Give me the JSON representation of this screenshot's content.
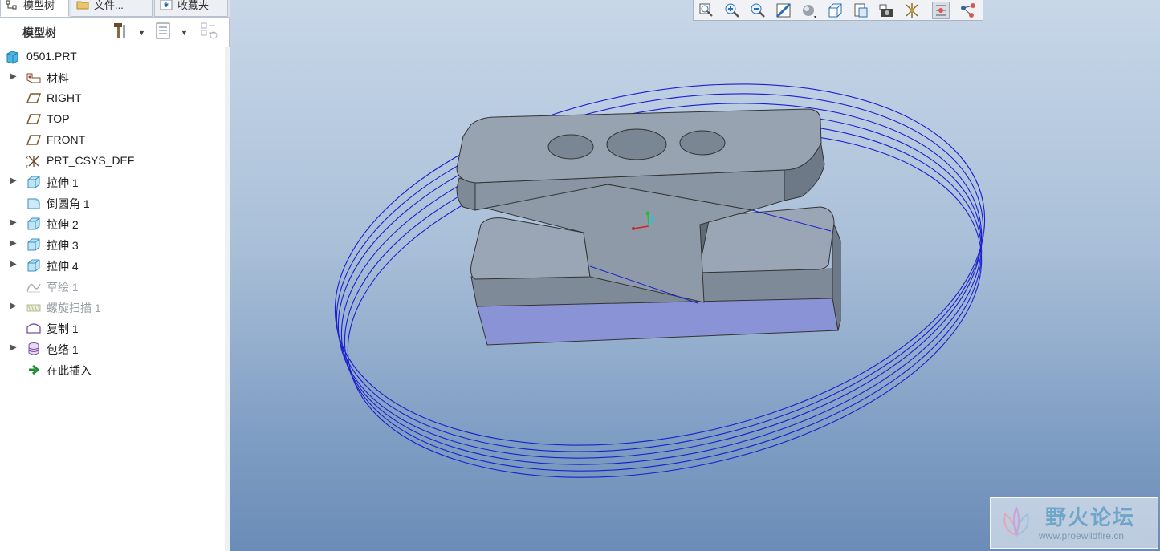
{
  "tabs": [
    {
      "label": "模型树"
    },
    {
      "label": "文件..."
    },
    {
      "label": "收藏夹"
    }
  ],
  "panel": {
    "title": "模型树"
  },
  "tree": {
    "root": "0501.PRT",
    "items": [
      {
        "label": "材料",
        "icon": "material-icon",
        "expandable": true
      },
      {
        "label": "RIGHT",
        "icon": "datum-plane-icon",
        "expandable": false
      },
      {
        "label": "TOP",
        "icon": "datum-plane-icon",
        "expandable": false
      },
      {
        "label": "FRONT",
        "icon": "datum-plane-icon",
        "expandable": false
      },
      {
        "label": "PRT_CSYS_DEF",
        "icon": "coordinate-system-icon",
        "expandable": false
      },
      {
        "label": "拉伸 1",
        "icon": "extrude-icon",
        "expandable": true
      },
      {
        "label": "倒圆角 1",
        "icon": "round-icon",
        "expandable": false
      },
      {
        "label": "拉伸 2",
        "icon": "extrude-icon",
        "expandable": true
      },
      {
        "label": "拉伸 3",
        "icon": "extrude-icon",
        "expandable": true
      },
      {
        "label": "拉伸 4",
        "icon": "extrude-icon",
        "expandable": true
      },
      {
        "label": "草绘 1",
        "icon": "sketch-icon",
        "expandable": false,
        "suppressed": true
      },
      {
        "label": "螺旋扫描 1",
        "icon": "helical-sweep-icon",
        "expandable": true,
        "suppressed": true
      },
      {
        "label": "复制 1",
        "icon": "copy-icon",
        "expandable": false
      },
      {
        "label": "包络 1",
        "icon": "wrap-icon",
        "expandable": true
      },
      {
        "label": "在此插入",
        "icon": "insert-here-icon",
        "expandable": false
      }
    ]
  },
  "view_toolbar": {
    "buttons": [
      "zoom-fit-icon",
      "zoom-in-icon",
      "zoom-out-icon",
      "repaint-icon",
      "display-style-icon",
      "saved-views-icon",
      "view-manager-icon",
      "screenshot-icon",
      "datum-display-icon",
      "spin-center-icon",
      "annotation-display-icon"
    ]
  },
  "watermark": {
    "title": "野火论坛",
    "url": "www.proewildfire.cn"
  },
  "colors": {
    "part_gray": "#97a3b1",
    "part_side": "#7f8a99",
    "part_bottom": "#8a93d6",
    "helix_blue": "#1c1fd0",
    "viewport_top": "#c8d7e8",
    "viewport_bottom": "#6a8cb7"
  }
}
